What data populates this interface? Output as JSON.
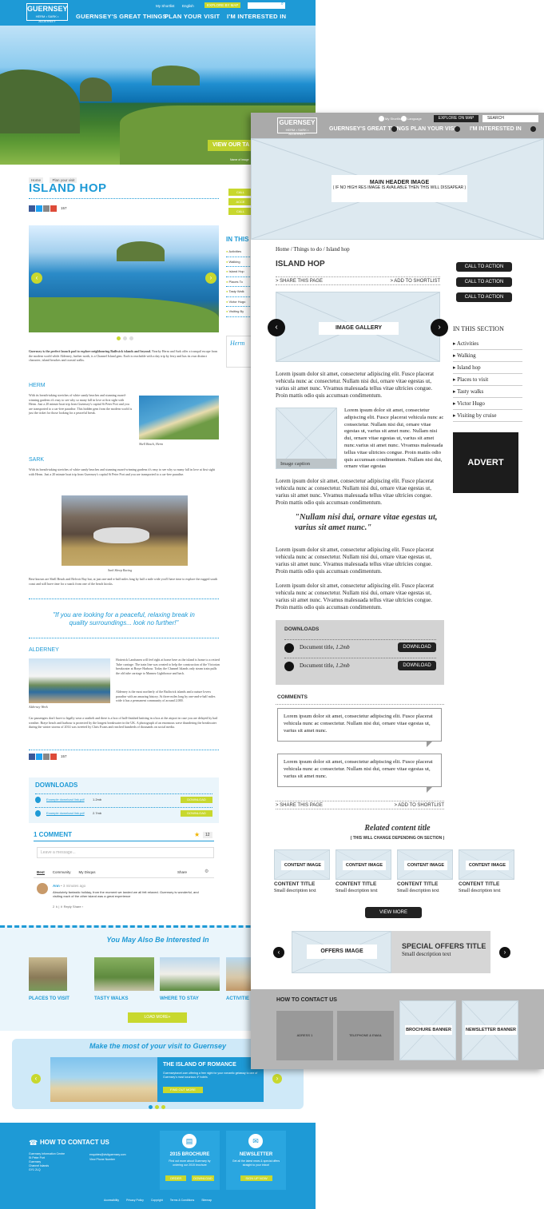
{
  "left": {
    "nav": {
      "logo": "GUERNSEY",
      "logo_sub": "HERM • SARK • ALDERNEY",
      "shortlist": "My Shortlist",
      "language": "English",
      "explore": "EXPLORE BY MAP",
      "links": [
        "GUERNSEY'S GREAT THINGS",
        "PLAN YOUR VISIT",
        "I'M INTERESTED IN"
      ]
    },
    "hero_cta": "VIEW OUR TA",
    "hero_caption": "Name of image",
    "breadcrumb": [
      "Home",
      "Plan your visit"
    ],
    "title": "ISLAND HOP",
    "share_count": "157",
    "side_buttons": [
      "CALL",
      "ACCE",
      "CALL"
    ],
    "in_this_section": "IN THIS",
    "section_items": [
      "Activities",
      "Walking",
      "Island Hop",
      "Places To",
      "Tasty Walk",
      "Victor Hugo",
      "Visiting By"
    ],
    "advert": "Herm",
    "intro": "Guernsey is the perfect launch pad to explore neighbouring Bailiwick islands and beyond.",
    "intro_body": "Nearby Herm and Sark offer a tranquil escape from the modern world while Alderney, further north, is a Channel Island gem. Each is reachable with a day trip by ferry and has its own distinct character, island beaches and coastal walks.",
    "herm_head": "HERM",
    "herm_body": "With its breath-taking stretches of white sandy beaches and stunning award-winning gardens it's easy to see why so many fall in love at first sight with Herm. Just a 20 minute boat trip from Guernsey's capital St Peter Port and you are transported to a car-free paradise. This hidden gem from the modern world is just the ticket for those looking for a peaceful break.",
    "herm_caption": "Shell Beach, Herm",
    "sark_head": "SARK",
    "sark_body": "With its breath-taking stretches of white sandy beaches and stunning award-winning gardens it's easy to see why so many fall in love at first sight with Herm. Just a 20 minute boat trip from Guernsey's capital St Peter Port and you are transported to a car-free paradise.",
    "sark_caption": "Sark Sheep Racing",
    "sark_body2": "Best-known are Shell Beach and Belvoir Bay but, at just one-and-a-half miles long by half a mile wide you'll have time to explore the rugged south coast and still have time for a snack from one of the beach kiosks.",
    "quote": "\"If you are looking for a peaceful, relaxing break in quality surroundings... look no further!\"",
    "alderney_head": "ALDERNEY",
    "alderney_caption": "Alderney Week",
    "alderney_body": "Hotterick Landsmen will feel right at home here as the island is home to a retired Tube carriage. The train line was created to help the construction of the Victorian breakwater at Braye Harbour. Today the Channel Islands only steam train pulls the old tube carriage to Mannez Lighthouse and back.",
    "alderney_body2": "Alderney is the most northerly of the Bailiwick islands and a nature lovers paradise with an amazing history. At three miles long by one-and-a-half miles wide it has a permanent community of around 2,000.",
    "alderney_body3": "Car passengers don't have to legally wear a seatbelt and there is a box of half-finished knitting in a box at the airport in case you are delayed by bad weather. Braye beach and harbour is protected by the longest breakwater in the UK. A photograph of an enormous wave thundering the breakwater during the winter storms of 2014 was tweeted by Chris Evans and reached hundreds of thousands on social media.",
    "downloads_head": "DOWNLOADS",
    "downloads": [
      {
        "name": "Example download link.pdf",
        "size": "1.2mb",
        "btn": "DOWNLOAD"
      },
      {
        "name": "Example download link.pdf",
        "size": "2.7mb",
        "btn": "DOWNLOAD"
      }
    ],
    "comment_head": "1 COMMENT",
    "comment_count": "12",
    "comment_placeholder": "Leave a message...",
    "comment_tabs": [
      "Best",
      "Community",
      "My Disqus"
    ],
    "share": "Share",
    "comment_author": "Ann",
    "comment_time": "• 3 minutes ago",
    "comment_text": "Absolutely fantastic holiday, from the moment we landed we all felt relaxed. Guernsey is wonderful, and visiting each of the other island was a great experience",
    "comment_actions": "2 ∧ | ∨   Reply  Share ›",
    "also_head": "You May Also Be Interested In",
    "also_items": [
      "PLACES TO VISIT",
      "TASTY WALKS",
      "WHERE TO STAY",
      "ACTIVITIE"
    ],
    "load_more": "LOAD MORE+",
    "make_most": "Make the most of your visit to Guernsey",
    "romance_title": "THE ISLAND OF ROMANCE",
    "romance_body": "Guernseytravel.com offering a free night for your romantic getaway to one of Guernsey's most luxurious 4* hotels",
    "find_out": "FIND OUT MORE",
    "contact_head": "HOW TO CONTACT US",
    "contact_addr": [
      "Guernsey Information Centre",
      "St Peter Port",
      "Guernsey",
      "Channel Islands",
      "GY1 2LQ"
    ],
    "contact_email": "enquiries@visitguernsey.com",
    "contact_phone": "View Phone Number",
    "brochure_head": "2015 BROCHURE",
    "brochure_body": "Find out more about Guernsey by ordering our 2015 brochure",
    "brochure_btns": [
      "ORDER",
      "DOWNLOAD"
    ],
    "newsletter_head": "NEWSLETTER",
    "newsletter_body": "Get all the latest news & special offers straight to your inbox!",
    "newsletter_btn": "SIGN UP NOW",
    "footer_links": [
      "Accessibility",
      "Privacy Policy",
      "Copyright",
      "Terms & Conditions",
      "Sitemap"
    ]
  },
  "right": {
    "top": {
      "shortlist": "My Shortlist",
      "language": "Language",
      "explore": "EXPLORE ON MAP",
      "search": "SEARCH"
    },
    "logo": "GUERNSEY",
    "logo_sub": "HERM • SARK • ALDERNEY",
    "nav_links": [
      "GUERNSEY'S GREAT THINGS",
      "PLAN YOUR VISIT",
      "I'M INTERESTED IN"
    ],
    "header_label": "MAIN HEADER IMAGE",
    "header_note": "( IF NO HIGH RES IMAGE IS AVAILABLE THEN THIS WILL DISSAPEAR )",
    "breadcrumb": "Home  /  Things to do  /  Island hop",
    "title": "ISLAND HOP",
    "share": "> SHARE THIS PAGE",
    "shortlist_add": "> ADD TO SHORTLIST",
    "gallery_label": "IMAGE GALLERY",
    "cta": [
      "CALL TO ACTION",
      "CALL TO ACTION",
      "CALL TO ACTION"
    ],
    "in_this_section": "IN THIS SECTION",
    "section_items": [
      "Activities",
      "Walking",
      "Island hop",
      "Places to visit",
      "Tasty walks",
      "Victor Hugo",
      "Visiting by cruise"
    ],
    "advert": "ADVERT",
    "lorem": "Lorem ipsum dolor sit amet, consectetur adipiscing elit. Fusce placerat vehicula nunc ac consectetur. Nullam nisi dui, ornare vitae egestas ut, varius sit amet nunc. Vivamus malesuada tellus vitae ultricies congue. Proin mattis odio quis accumsan condimentum.",
    "lorem_img": "Lorem ipsum dolor sit amet, consectetur adipiscing elit. Fusce placerat vehicula nunc ac consectetur. Nullam nisi dui, ornare vitae egestas ut, varius sit amet nunc. Nullam nisi dui, ornare vitae egestas ut, varius sit amet nunc.varius sit amet nunc. Vivamus malesuada tellus vitae ultricies congue. Proin mattis odio quis accumsan condimentum. Nullam nisi dui, ornare vitae egestas",
    "image_caption": "Image caption",
    "quote": "\"Nullam nisi dui, ornare vitae egestas ut, varius sit amet nunc.\"",
    "downloads_head": "DOWNLOADS",
    "downloads": [
      {
        "title": "Document title, ",
        "size": "1.2mb",
        "btn": "DOWNLOAD"
      },
      {
        "title": "Document title, ",
        "size": "1.2mb",
        "btn": "DOWNLOAD"
      }
    ],
    "comments_head": "COMMENTS",
    "comment_text": "Lorem ipsum dolor sit amet, consectetur adipiscing elit. Fusce placerat vehicula nunc ac consectetur. Nullam nisi dui, ornare vitae egestas ut, varius sit amet nunc.",
    "related_title": "Related content title",
    "related_note": "( THIS WILL CHANGE DEPENDING ON SECTION )",
    "content_image": "CONTENT IMAGE",
    "content_title": "CONTENT TITLE",
    "content_desc": "Small description text",
    "view_more": "VIEW MORE",
    "offers_image": "OFFERS IMAGE",
    "offers_title": "SPECIAL OFFERS TITLE",
    "offers_desc": "Small description text",
    "contact_head": "HOW TO CONTACT US",
    "address": "ADRESS 1",
    "tel": "TELEPHONE & EMAIL",
    "brochure": "BROCHURE BANNER",
    "newsletter": "NEWSLETTER BANNER"
  }
}
